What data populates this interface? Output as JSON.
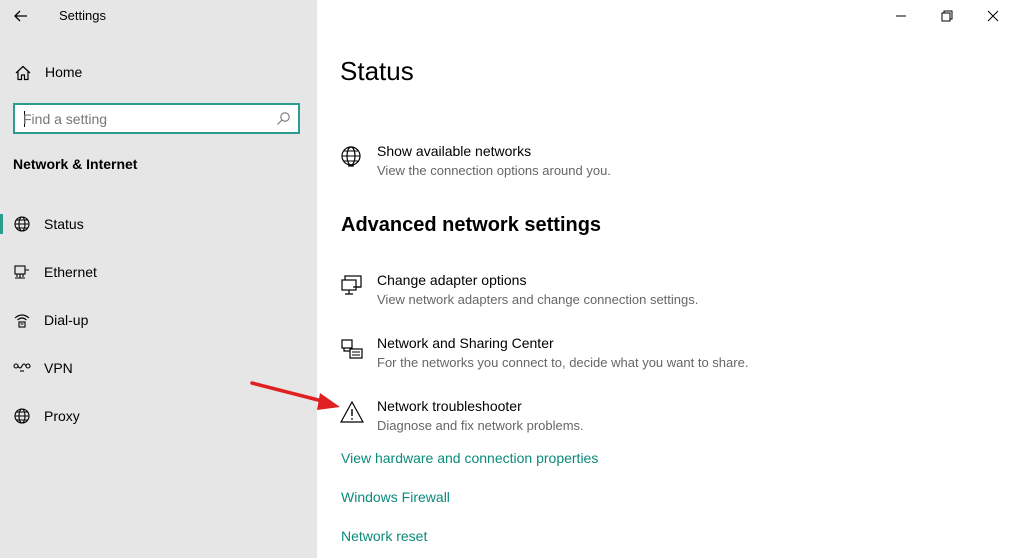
{
  "window": {
    "app_title": "Settings"
  },
  "sidebar": {
    "home_label": "Home",
    "search": {
      "placeholder": "Find a setting",
      "value": ""
    },
    "section_title": "Network & Internet",
    "items": [
      {
        "label": "Status",
        "icon": "globe-icon",
        "active": true
      },
      {
        "label": "Ethernet",
        "icon": "ethernet-icon",
        "active": false
      },
      {
        "label": "Dial-up",
        "icon": "dialup-icon",
        "active": false
      },
      {
        "label": "VPN",
        "icon": "vpn-icon",
        "active": false
      },
      {
        "label": "Proxy",
        "icon": "globe-icon",
        "active": false
      }
    ]
  },
  "main": {
    "title": "Status",
    "show_networks": {
      "title": "Show available networks",
      "desc": "View the connection options around you."
    },
    "advanced_heading": "Advanced network settings",
    "advanced_items": [
      {
        "title": "Change adapter options",
        "desc": "View network adapters and change connection settings.",
        "icon": "adapter-icon"
      },
      {
        "title": "Network and Sharing Center",
        "desc": "For the networks you connect to, decide what you want to share.",
        "icon": "sharing-center-icon"
      },
      {
        "title": "Network troubleshooter",
        "desc": "Diagnose and fix network problems.",
        "icon": "warning-icon"
      }
    ],
    "links": [
      "View hardware and connection properties",
      "Windows Firewall",
      "Network reset"
    ]
  },
  "colors": {
    "accent": "#2a9d8f",
    "link": "#0b8a7a",
    "sidebar_bg": "#e6e6e6",
    "annotation_arrow": "#e02020"
  }
}
